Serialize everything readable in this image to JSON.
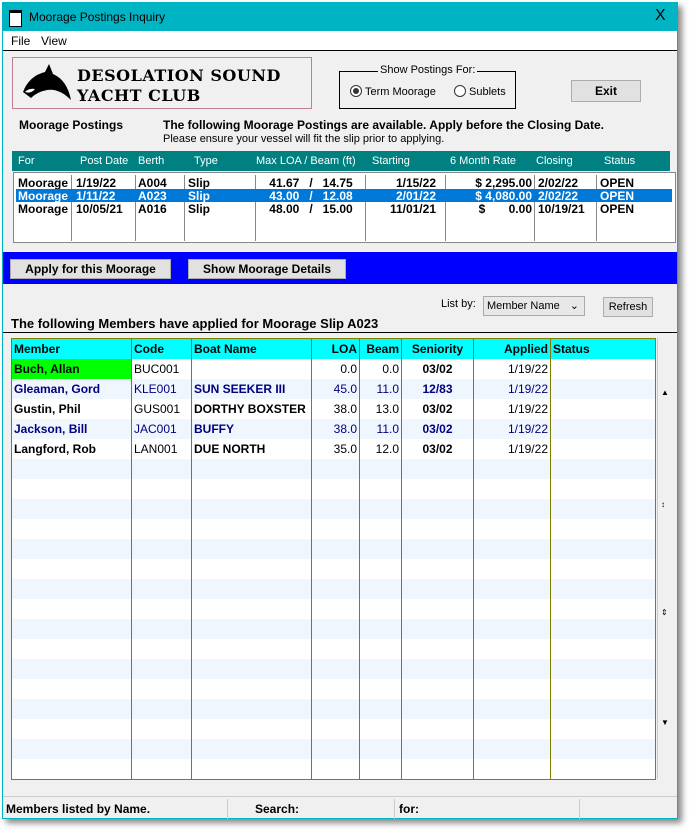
{
  "window": {
    "title": "Moorage Postings Inquiry",
    "close": "X"
  },
  "menu": [
    "File",
    "View"
  ],
  "logo": {
    "line1": "DESOLATION SOUND",
    "line2": "YACHT CLUB"
  },
  "show_postings": {
    "legend": "Show Postings For:",
    "options": [
      {
        "label": "Term Moorage",
        "selected": true
      },
      {
        "label": "Sublets",
        "selected": false
      }
    ]
  },
  "exit_label": "Exit",
  "postings_label": "Moorage Postings",
  "notice1": "The following Moorage Postings are available.  Apply before the Closing Date.",
  "notice2": "Please ensure your vessel will fit the slip prior to applying.",
  "postings": {
    "headers": [
      "For",
      "Post Date",
      "Berth",
      "Type",
      "Max LOA / Beam (ft)",
      "Starting",
      "6 Month Rate",
      "Closing",
      "Status"
    ],
    "rows": [
      [
        "Moorage",
        "1/19/22",
        "A004",
        "Slip",
        "41.67   /   14.75",
        "1/15/22",
        "$ 2,295.00",
        "2/02/22",
        "OPEN"
      ],
      [
        "Moorage",
        "1/11/22",
        "A023",
        "Slip",
        "43.00   /   12.08",
        "2/01/22",
        "$ 4,080.00",
        "2/02/22",
        "OPEN"
      ],
      [
        "Moorage",
        "10/05/21",
        "A016",
        "Slip",
        "48.00   /   15.00",
        "11/01/21",
        "$       0.00",
        "10/19/21",
        "OPEN"
      ]
    ],
    "selected_index": 1
  },
  "apply_label": "Apply for this Moorage",
  "details_label": "Show Moorage Details",
  "list_by": {
    "label": "List by:",
    "value": "Member Name"
  },
  "refresh_label": "Refresh",
  "applicants_title": "The following Members have applied for Moorage Slip A023",
  "applicants": {
    "headers": [
      "Member",
      "Code",
      "Boat Name",
      "LOA",
      "Beam",
      "Seniority",
      "Applied",
      "Status"
    ],
    "rows": [
      [
        "Buch, Allan",
        "BUC001",
        "",
        "0.0",
        "0.0",
        "03/02",
        "1/19/22",
        ""
      ],
      [
        "Gleaman, Gord",
        "KLE001",
        "SUN SEEKER III",
        "45.0",
        "11.0",
        "12/83",
        "1/19/22",
        ""
      ],
      [
        "Gustin, Phil",
        "GUS001",
        "DORTHY BOXSTER",
        "38.0",
        "13.0",
        "03/02",
        "1/19/22",
        ""
      ],
      [
        "Jackson, Bill",
        "JAC001",
        "BUFFY",
        "38.0",
        "11.0",
        "03/02",
        "1/19/22",
        ""
      ],
      [
        "Langford, Rob",
        "LAN001",
        "DUE NORTH",
        "35.0",
        "12.0",
        "03/02",
        "1/19/22",
        ""
      ]
    ]
  },
  "status_bar": {
    "left": "Members listed by Name.",
    "search": "Search:",
    "for": "for:"
  },
  "colors": {
    "title_bar": "#00b4c4",
    "postings_header": "#008080",
    "band": "#0000ff",
    "grid_header": "#00ffff",
    "highlight": "#00ff00",
    "alt_text": "#000080"
  }
}
